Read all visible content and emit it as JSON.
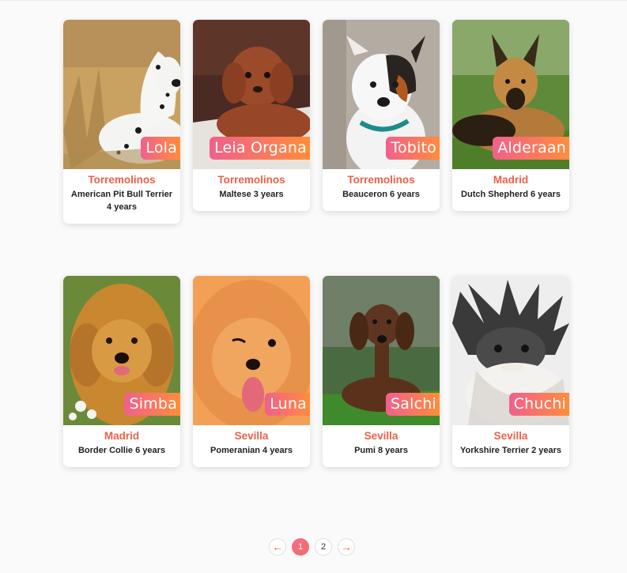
{
  "colors": {
    "accent_pink": "#f0608d",
    "accent_orange": "#ff8d3a",
    "city_text": "#ef6048"
  },
  "dogs": [
    {
      "name": "Lola",
      "city": "Torremolinos",
      "description": "American Pit Bull Terrier 4 years"
    },
    {
      "name": "Leia Organa",
      "city": "Torremolinos",
      "description": "Maltese 3 years"
    },
    {
      "name": "Tobito",
      "city": "Torremolinos",
      "description": "Beauceron 6 years"
    },
    {
      "name": "Alderaan",
      "city": "Madrid",
      "description": "Dutch Shepherd 6 years"
    },
    {
      "name": "Simba",
      "city": "Madrid",
      "description": "Border Collie 6 years"
    },
    {
      "name": "Luna",
      "city": "Sevilla",
      "description": "Pomeranian 4 years"
    },
    {
      "name": "Salchi",
      "city": "Sevilla",
      "description": "Pumi 8 years"
    },
    {
      "name": "Chuchi",
      "city": "Sevilla",
      "description": "Yorkshire Terrier 2 years"
    }
  ],
  "pagination": {
    "prev_icon": "arrow-left-icon",
    "prev_label": "←",
    "pages": [
      "1",
      "2"
    ],
    "current": "1",
    "next_icon": "arrow-right-icon",
    "next_label": "→"
  }
}
